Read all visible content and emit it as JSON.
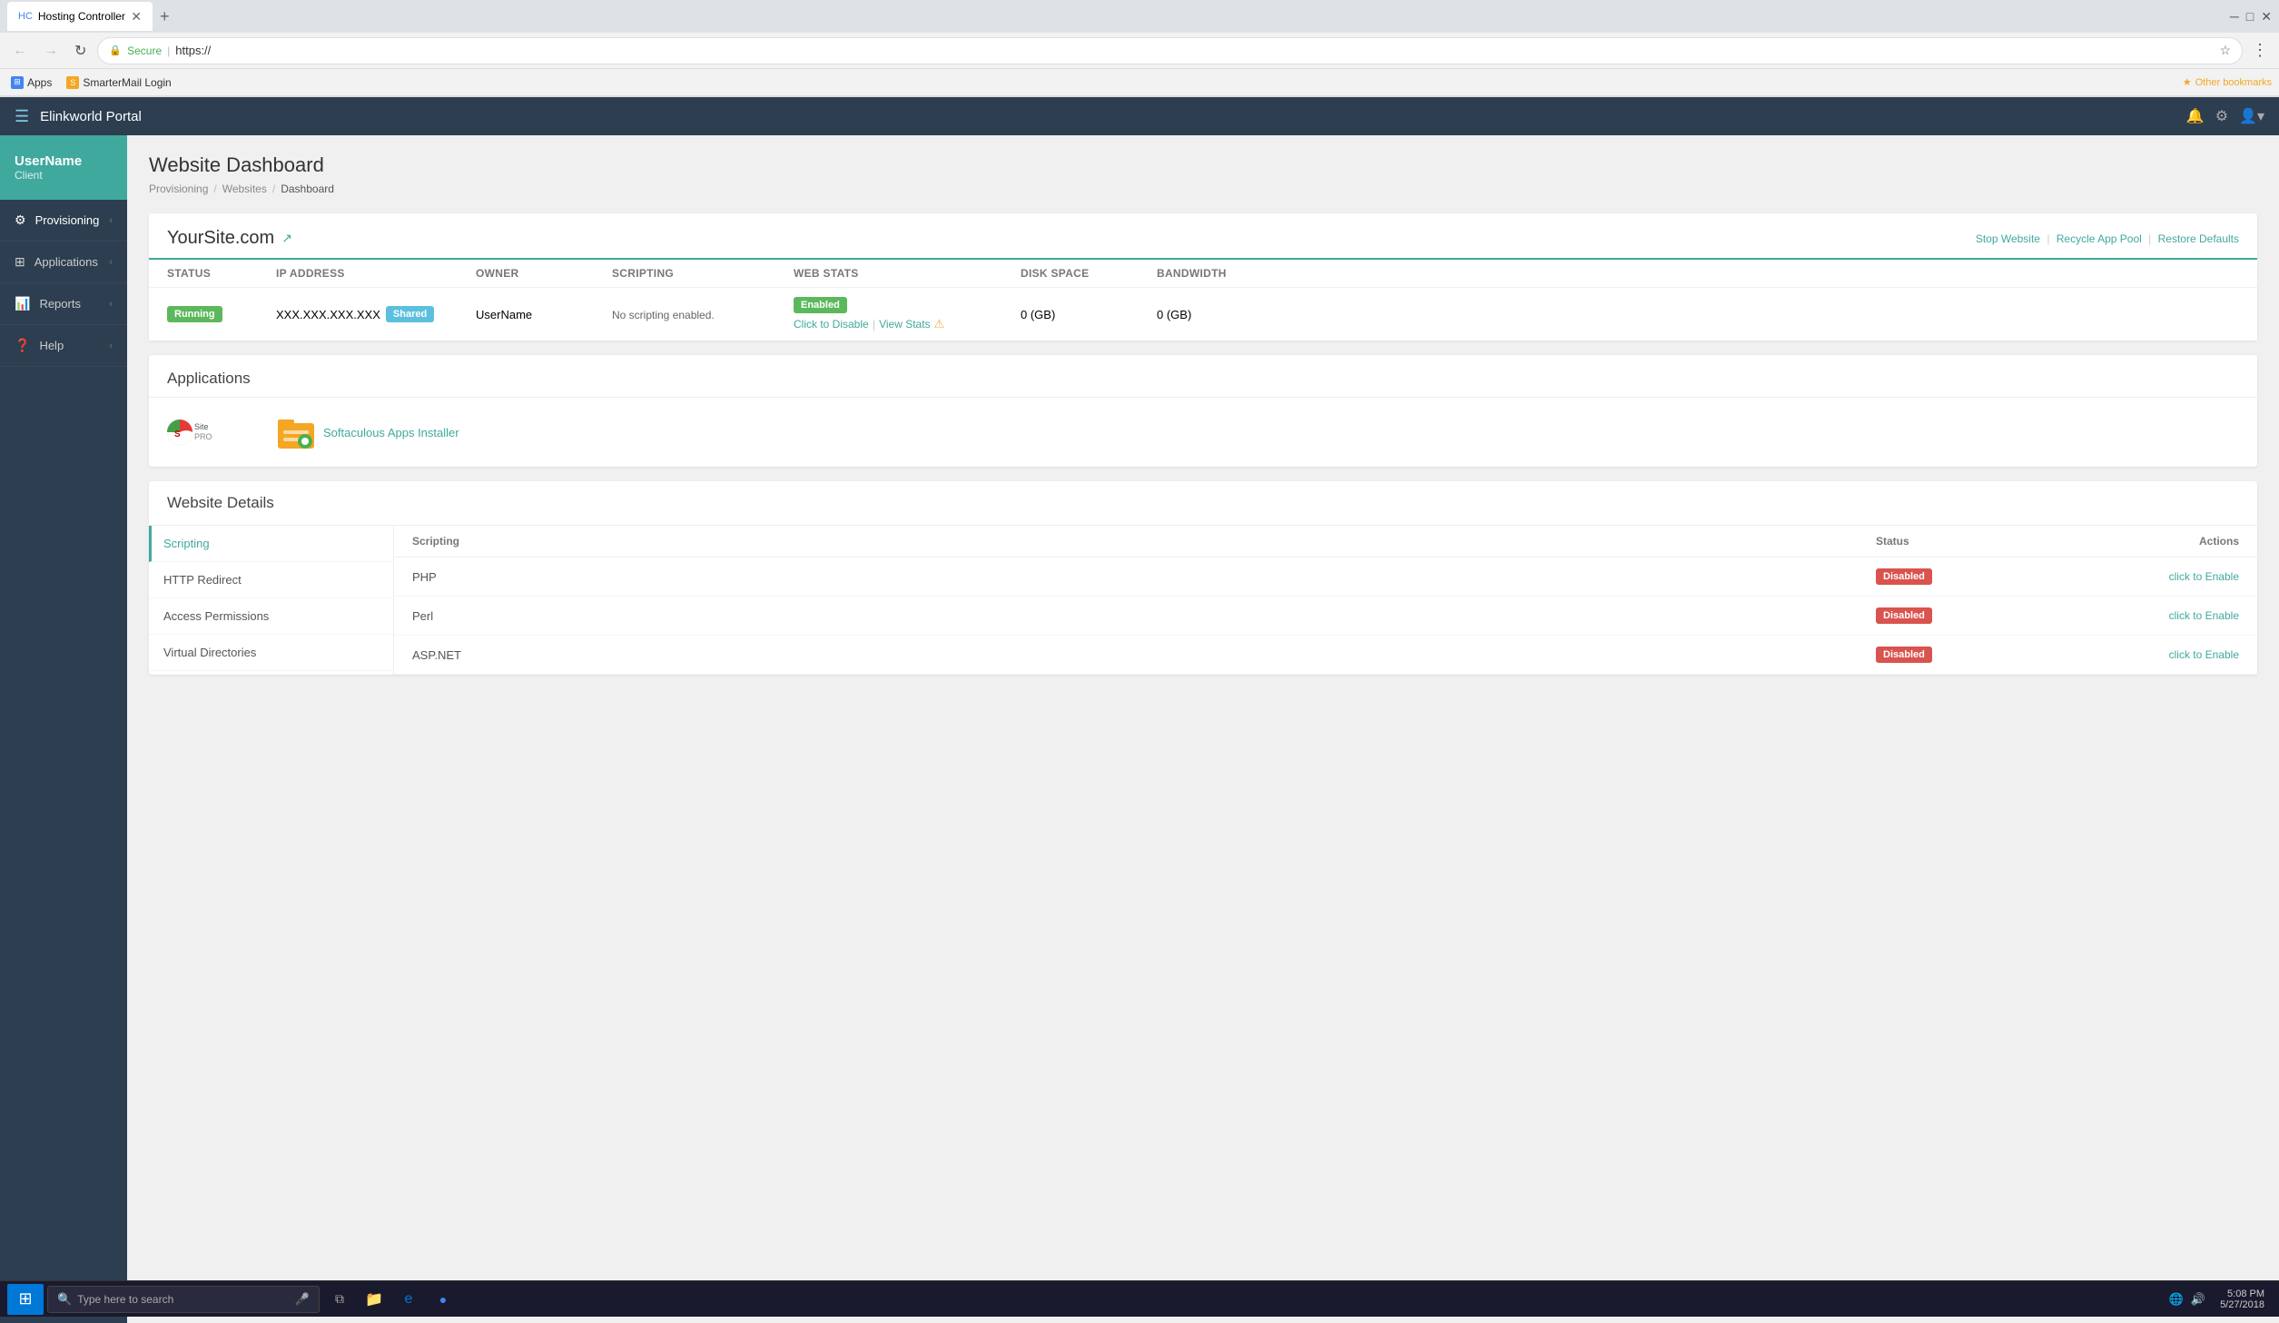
{
  "browser": {
    "tab": {
      "title": "Hosting Controller",
      "favicon": "HC"
    },
    "address": {
      "secure_label": "Secure",
      "url": "https://"
    },
    "bookmarks": [
      {
        "id": "apps",
        "label": "Apps",
        "type": "apps"
      },
      {
        "id": "smartermail",
        "label": "SmarterMail Login",
        "type": "yellow"
      }
    ],
    "other_bookmarks_label": "Other bookmarks"
  },
  "navbar": {
    "portal_name": "Elinkworld Portal",
    "hamburger": "☰"
  },
  "sidebar": {
    "user": {
      "name": "UserName",
      "role": "Client"
    },
    "items": [
      {
        "id": "provisioning",
        "label": "Provisioning",
        "icon": "⚙",
        "has_chevron": true
      },
      {
        "id": "applications",
        "label": "Applications",
        "icon": "⊞",
        "has_chevron": true
      },
      {
        "id": "reports",
        "label": "Reports",
        "icon": "📊",
        "has_chevron": true
      },
      {
        "id": "help",
        "label": "Help",
        "icon": "?",
        "has_chevron": true
      }
    ]
  },
  "page": {
    "title": "Website Dashboard",
    "breadcrumb": [
      {
        "label": "Provisioning",
        "link": true
      },
      {
        "label": "Websites",
        "link": true
      },
      {
        "label": "Dashboard",
        "link": false
      }
    ]
  },
  "website_card": {
    "site_name": "YourSite.com",
    "actions": {
      "stop": "Stop Website",
      "recycle": "Recycle App Pool",
      "restore": "Restore Defaults"
    },
    "table": {
      "headers": [
        "Status",
        "IP Address",
        "Owner",
        "Scripting",
        "Web Stats",
        "Disk Space",
        "Bandwidth"
      ],
      "row": {
        "status": "Running",
        "ip": "XXX.XXX.XXX.XXX",
        "ip_type": "Shared",
        "owner": "UserName",
        "scripting": "No scripting enabled.",
        "web_stats_status": "Enabled",
        "web_stats_disable": "Click to Disable",
        "web_stats_view": "View Stats",
        "disk_space": "0 (GB)",
        "bandwidth": "0 (GB)"
      }
    }
  },
  "applications_section": {
    "title": "Applications",
    "items": [
      {
        "id": "sitepro",
        "name": "Site Pro",
        "type": "sitepro"
      },
      {
        "id": "softaculous",
        "name": "Softaculous Apps Installer",
        "type": "softaculous"
      }
    ]
  },
  "website_details": {
    "title": "Website Details",
    "nav_items": [
      {
        "id": "scripting",
        "label": "Scripting",
        "active": true
      },
      {
        "id": "http-redirect",
        "label": "HTTP Redirect",
        "active": false
      },
      {
        "id": "access-permissions",
        "label": "Access Permissions",
        "active": false
      },
      {
        "id": "virtual-directories",
        "label": "Virtual Directories",
        "active": false
      }
    ],
    "scripting": {
      "headers": [
        "Scripting",
        "Status",
        "Actions"
      ],
      "rows": [
        {
          "name": "PHP",
          "status": "Disabled",
          "action": "click to Enable"
        },
        {
          "name": "Perl",
          "status": "Disabled",
          "action": "click to Enable"
        },
        {
          "name": "ASP.NET",
          "status": "Disabled",
          "action": "click to Enable"
        }
      ]
    }
  },
  "taskbar": {
    "search_placeholder": "Type here to search",
    "time": "5:08 PM",
    "date": "5/27/2018"
  }
}
